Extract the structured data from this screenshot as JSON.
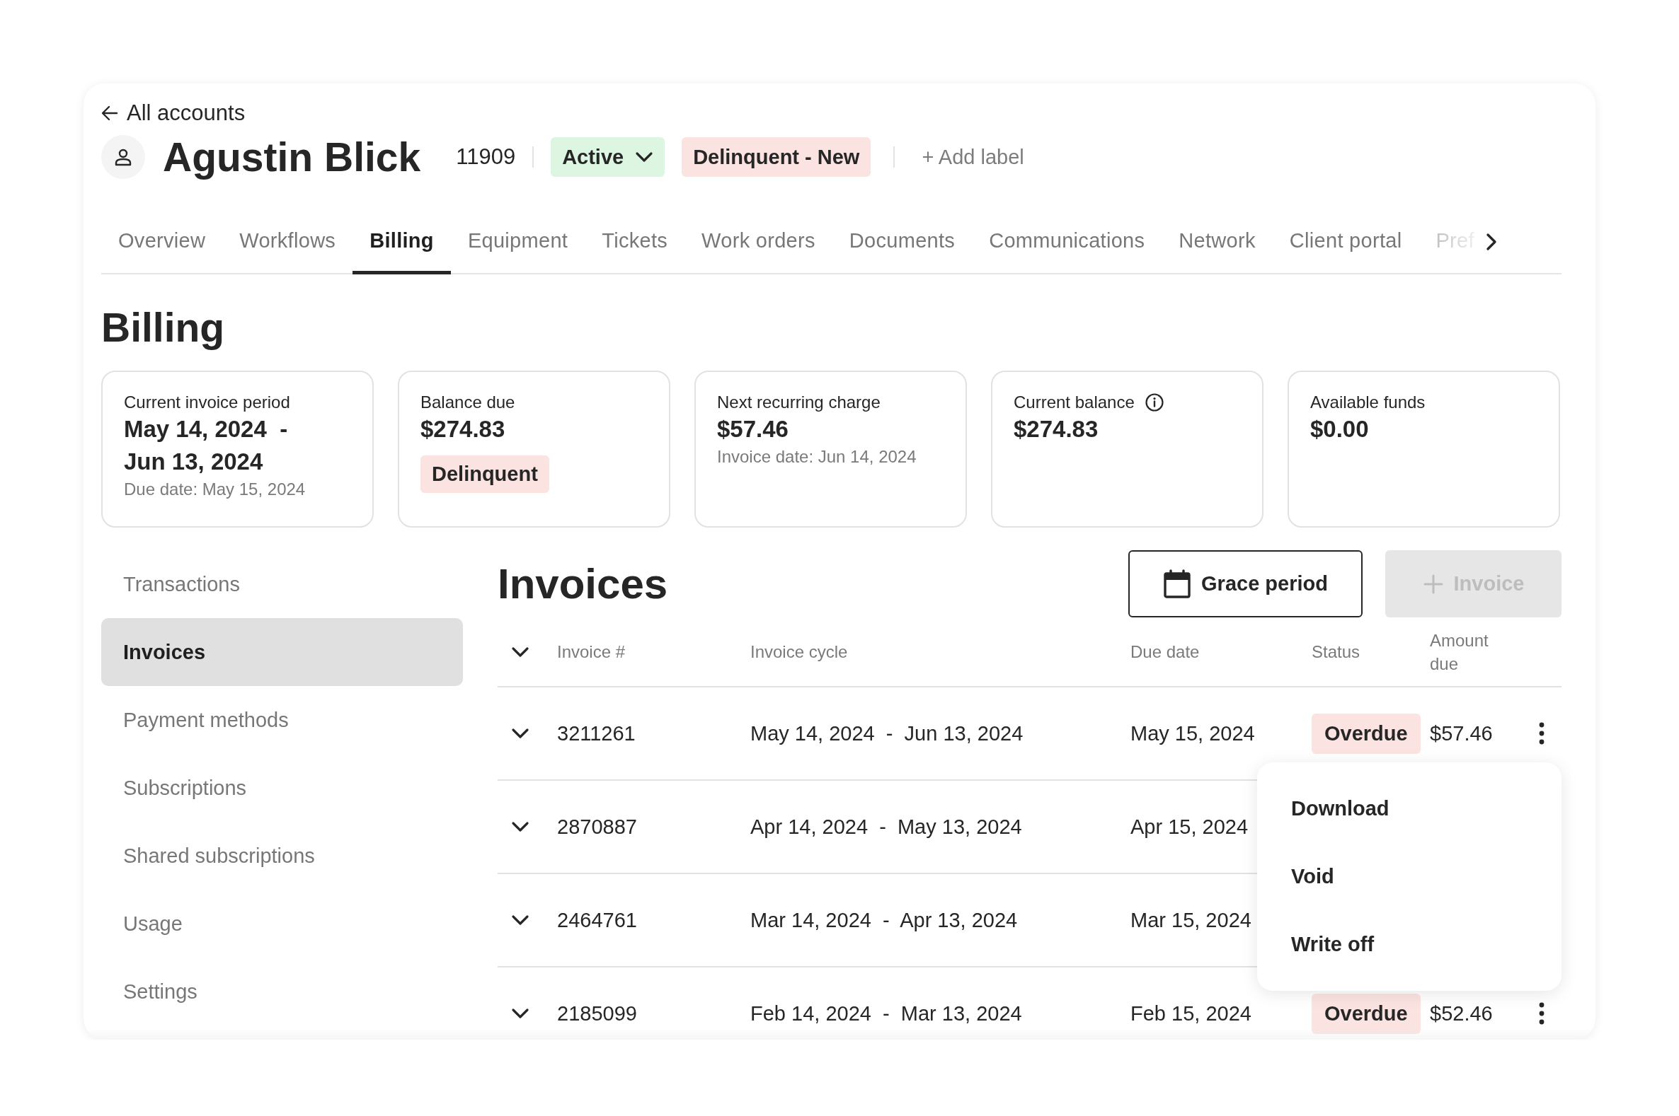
{
  "back_link": {
    "label": "All accounts"
  },
  "account": {
    "name": "Agustin Blick",
    "number": "11909",
    "status": {
      "label": "Active"
    },
    "labels": [
      {
        "label": "Delinquent - New"
      }
    ],
    "add_label": "+ Add label"
  },
  "tabs": [
    {
      "label": "Overview",
      "selected": false
    },
    {
      "label": "Workflows",
      "selected": false
    },
    {
      "label": "Billing",
      "selected": true
    },
    {
      "label": "Equipment",
      "selected": false
    },
    {
      "label": "Tickets",
      "selected": false
    },
    {
      "label": "Work orders",
      "selected": false
    },
    {
      "label": "Documents",
      "selected": false
    },
    {
      "label": "Communications",
      "selected": false
    },
    {
      "label": "Network",
      "selected": false
    },
    {
      "label": "Client portal",
      "selected": false
    },
    {
      "label": "Pref",
      "selected": false,
      "faded": true
    }
  ],
  "page_title": "Billing",
  "summary_cards": [
    {
      "title": "Current invoice period",
      "value_lines": [
        "May 14, 2024  -",
        "Jun 13, 2024"
      ],
      "note": "Due date: May 15, 2024"
    },
    {
      "title": "Balance due",
      "value_lines": [
        "$274.83"
      ],
      "badge": "Delinquent"
    },
    {
      "title": "Next recurring charge",
      "value_lines": [
        "$57.46"
      ],
      "note": "Invoice date: Jun 14, 2024"
    },
    {
      "title": "Current balance",
      "info": true,
      "value_lines": [
        "$274.83"
      ]
    },
    {
      "title": "Available funds",
      "value_lines": [
        "$0.00"
      ]
    }
  ],
  "sidebar": {
    "items": [
      {
        "label": "Transactions",
        "selected": false
      },
      {
        "label": "Invoices",
        "selected": true
      },
      {
        "label": "Payment methods",
        "selected": false
      },
      {
        "label": "Subscriptions",
        "selected": false
      },
      {
        "label": "Shared subscriptions",
        "selected": false
      },
      {
        "label": "Usage",
        "selected": false
      },
      {
        "label": "Settings",
        "selected": false
      }
    ]
  },
  "invoices": {
    "title": "Invoices",
    "buttons": [
      {
        "label": "Grace period",
        "kind": "outline",
        "disabled": false
      },
      {
        "label": "Invoice",
        "kind": "add",
        "disabled": true
      }
    ],
    "table": {
      "columns": [
        "Invoice #",
        "Invoice cycle",
        "Due date",
        "Status",
        "Amount due"
      ],
      "rows": [
        {
          "invoice": "3211261",
          "cycle": "May 14, 2024  -  Jun 13, 2024",
          "due_date": "May 15, 2024",
          "status": "Overdue",
          "amount": "$57.46"
        },
        {
          "invoice": "2870887",
          "cycle": "Apr 14, 2024  -  May 13, 2024",
          "due_date": "Apr 15, 2024"
        },
        {
          "invoice": "2464761",
          "cycle": "Mar 14, 2024  -  Apr 13, 2024",
          "due_date": "Mar 15, 2024"
        },
        {
          "invoice": "2185099",
          "cycle": "Feb 14, 2024  -  Mar 13, 2024",
          "due_date": "Feb 15, 2024",
          "status": "Overdue",
          "amount": "$52.46"
        }
      ]
    },
    "row_menu": {
      "items": [
        "Download",
        "Void",
        "Write off"
      ]
    }
  }
}
